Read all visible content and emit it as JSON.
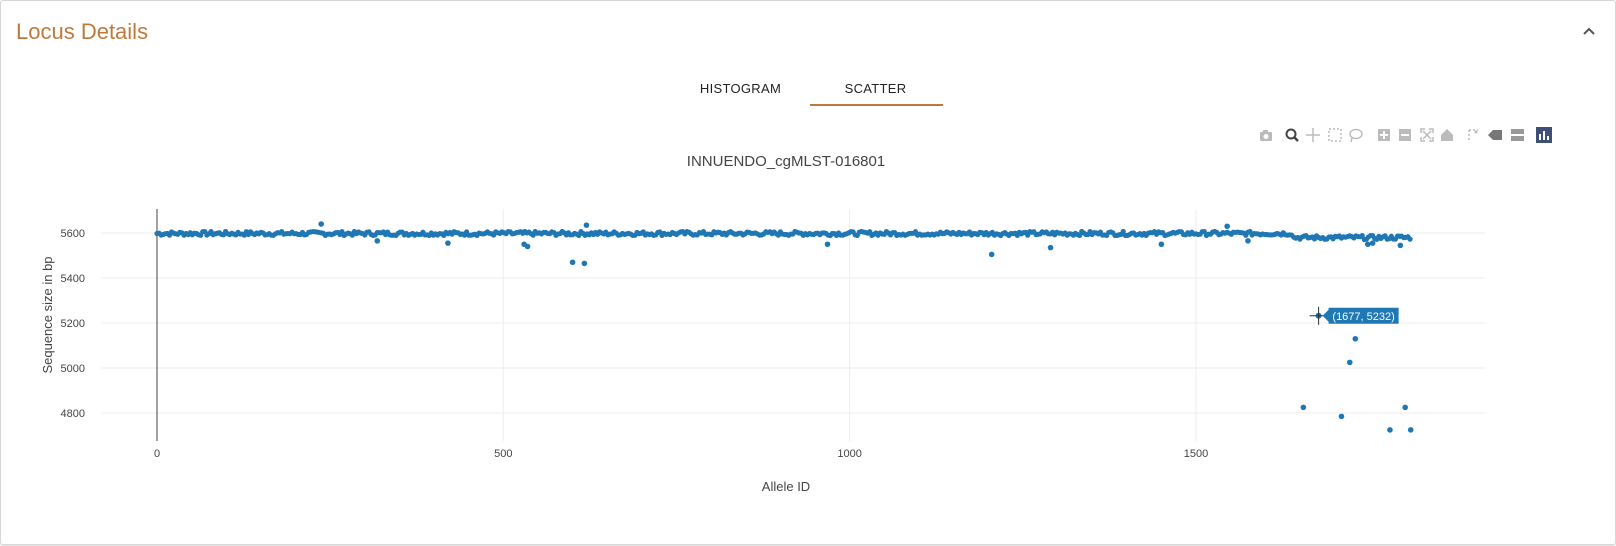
{
  "panel": {
    "title": "Locus Details"
  },
  "tabs": [
    {
      "label": "HISTOGRAM"
    },
    {
      "label": "SCATTER"
    }
  ],
  "colors": {
    "accent": "#c0793a",
    "marker": "#1f77b4",
    "hover_bg": "#1f77b4"
  },
  "modebar_icons": [
    "camera-icon",
    "zoom-icon",
    "pan-icon",
    "box-select-icon",
    "lasso-select-icon",
    "zoom-in-icon",
    "zoom-out-icon",
    "autoscale-icon",
    "reset-axes-icon",
    "spike-lines-icon",
    "hover-closest-icon",
    "hover-compare-icon",
    "plotly-logo-icon"
  ],
  "chart_data": {
    "type": "scatter",
    "title": "INNUENDO_cgMLST-016801",
    "xlabel": "Allele ID",
    "ylabel": "Sequence size in bp",
    "xlim": [
      -50,
      1920
    ],
    "ylim": [
      4700,
      5700
    ],
    "xticks": [
      0,
      500,
      1000,
      1500
    ],
    "yticks": [
      4800,
      5000,
      5200,
      5400,
      5600
    ],
    "grid": true,
    "dense_band": {
      "x_range": [
        0,
        1810
      ],
      "y": 5598,
      "note_y_after_1640": 5580
    },
    "points": [
      [
        237,
        5640
      ],
      [
        318,
        5565
      ],
      [
        420,
        5555
      ],
      [
        530,
        5550
      ],
      [
        535,
        5540
      ],
      [
        600,
        5470
      ],
      [
        617,
        5465
      ],
      [
        620,
        5635
      ],
      [
        968,
        5550
      ],
      [
        1205,
        5505
      ],
      [
        1290,
        5535
      ],
      [
        1450,
        5550
      ],
      [
        1545,
        5630
      ],
      [
        1575,
        5565
      ],
      [
        1748,
        5550
      ],
      [
        1755,
        5555
      ],
      [
        1795,
        5545
      ],
      [
        1655,
        4825
      ],
      [
        1710,
        4785
      ],
      [
        1722,
        5025
      ],
      [
        1730,
        5130
      ],
      [
        1780,
        4725
      ],
      [
        1802,
        4825
      ],
      [
        1810,
        4725
      ]
    ],
    "hover": {
      "x": 1677,
      "y": 5232,
      "label": "(1677, 5232)"
    }
  }
}
